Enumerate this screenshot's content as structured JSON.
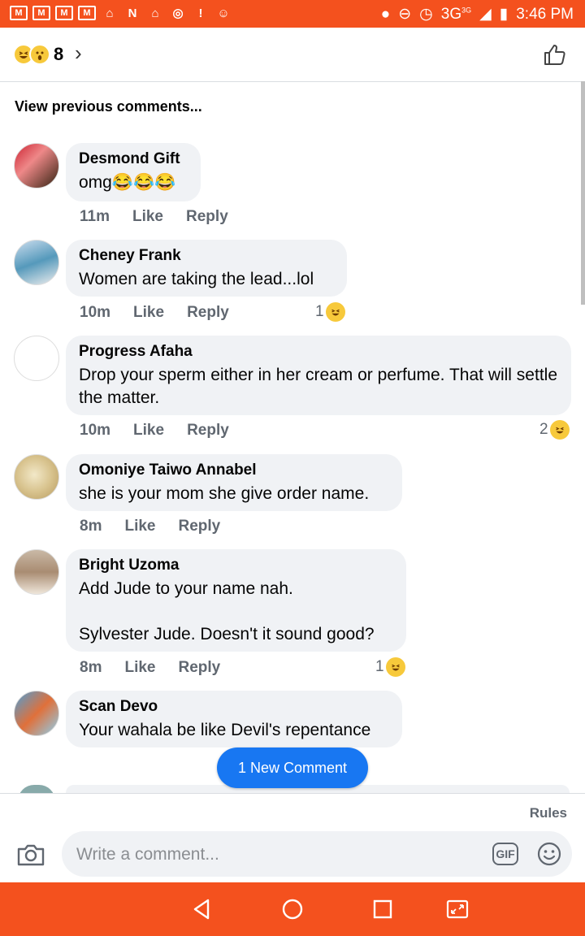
{
  "status_bar": {
    "network": "3G",
    "network_sup": "3G",
    "time": "3:46 PM"
  },
  "reactions_bar": {
    "count": "8",
    "emoji_icons": [
      "laughing-emoji-icon",
      "surprised-emoji-icon"
    ]
  },
  "view_previous": "View previous comments...",
  "comments": [
    {
      "author": "Desmond Gift",
      "text": "omg😂😂😂",
      "time": "11m",
      "like": "Like",
      "reply": "Reply",
      "reactions": ""
    },
    {
      "author": "Cheney Frank",
      "text": "Women are taking the lead...lol",
      "time": "10m",
      "like": "Like",
      "reply": "Reply",
      "reactions": "1"
    },
    {
      "author": "Progress Afaha",
      "text": "Drop your sperm either in her cream or perfume. That will settle the matter.",
      "time": "10m",
      "like": "Like",
      "reply": "Reply",
      "reactions": "2"
    },
    {
      "author": "Omoniye Taiwo Annabel",
      "text": "she is your mom she give order name.",
      "time": "8m",
      "like": "Like",
      "reply": "Reply",
      "reactions": ""
    },
    {
      "author": "Bright Uzoma",
      "text": "Add Jude to your name nah.\n\nSylvester Jude. Doesn't it sound good?",
      "time": "8m",
      "like": "Like",
      "reply": "Reply",
      "reactions": "1"
    },
    {
      "author": "Scan Devo",
      "text": "Your wahala be like Devil's repentance",
      "time": "",
      "like": "",
      "reply": "",
      "reactions": ""
    }
  ],
  "new_comment_button": "1 New Comment",
  "composer": {
    "rules": "Rules",
    "placeholder": "Write a comment...",
    "gif": "GIF"
  },
  "colors": {
    "accent": "#f4511e",
    "primary_blue": "#1877f2",
    "bubble": "#f0f2f5",
    "meta_text": "#606770"
  }
}
